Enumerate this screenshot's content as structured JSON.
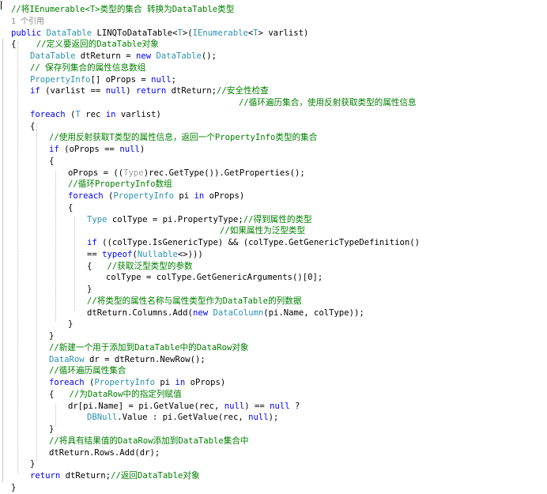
{
  "editor": {
    "lines": [
      {
        "indent": 0,
        "tokens": [
          {
            "t": "//将IEnumerable<T>类型的集合 转换为DataTable类型",
            "c": "cm"
          }
        ]
      },
      {
        "indent": 0,
        "tokens": [
          {
            "t": "1 个引用",
            "c": "ref"
          }
        ]
      },
      {
        "indent": 0,
        "tokens": [
          {
            "t": "public",
            "c": "kw"
          },
          {
            "t": " "
          },
          {
            "t": "DataTable",
            "c": "ty"
          },
          {
            "t": " LINQToDataTable<"
          },
          {
            "t": "T",
            "c": "ty"
          },
          {
            "t": ">("
          },
          {
            "t": "IEnumerable",
            "c": "ty"
          },
          {
            "t": "<"
          },
          {
            "t": "T",
            "c": "ty"
          },
          {
            "t": "> varlist)"
          }
        ]
      },
      {
        "indent": 0,
        "tokens": [
          {
            "t": "{"
          },
          {
            "t": "    "
          },
          {
            "t": "//定义要返回的DataTable对象",
            "c": "cm"
          }
        ]
      },
      {
        "indent": 1,
        "tokens": [
          {
            "t": "DataTable",
            "c": "ty"
          },
          {
            "t": " dtReturn = "
          },
          {
            "t": "new",
            "c": "kw"
          },
          {
            "t": " "
          },
          {
            "t": "DataTable",
            "c": "ty"
          },
          {
            "t": "();"
          }
        ]
      },
      {
        "indent": 1,
        "tokens": [
          {
            "t": "// 保存列集合的属性信息数组",
            "c": "cm"
          }
        ]
      },
      {
        "indent": 1,
        "tokens": [
          {
            "t": "PropertyInfo",
            "c": "ty"
          },
          {
            "t": "[] oProps = "
          },
          {
            "t": "null",
            "c": "kw"
          },
          {
            "t": ";"
          }
        ]
      },
      {
        "indent": 1,
        "tokens": [
          {
            "t": "if",
            "c": "kw"
          },
          {
            "t": " (varlist == "
          },
          {
            "t": "null",
            "c": "kw"
          },
          {
            "t": ") "
          },
          {
            "t": "return",
            "c": "kw"
          },
          {
            "t": " dtReturn;"
          },
          {
            "t": "//安全性检查",
            "c": "cm"
          }
        ]
      },
      {
        "indent": 12,
        "tokens": [
          {
            "t": "//循环遍历集合，使用反射获取类型的属性信息",
            "c": "cm"
          }
        ]
      },
      {
        "indent": 1,
        "tokens": [
          {
            "t": "foreach",
            "c": "kw"
          },
          {
            "t": " ("
          },
          {
            "t": "T",
            "c": "ty"
          },
          {
            "t": " rec "
          },
          {
            "t": "in",
            "c": "kw"
          },
          {
            "t": " varlist)"
          }
        ]
      },
      {
        "indent": 1,
        "tokens": [
          {
            "t": "{"
          }
        ]
      },
      {
        "indent": 2,
        "tokens": [
          {
            "t": "//使用反射获取T类型的属性信息，返回一个PropertyInfo类型的集合",
            "c": "cm"
          }
        ]
      },
      {
        "indent": 2,
        "tokens": [
          {
            "t": "if",
            "c": "kw"
          },
          {
            "t": " (oProps == "
          },
          {
            "t": "null",
            "c": "kw"
          },
          {
            "t": ")"
          }
        ]
      },
      {
        "indent": 2,
        "tokens": [
          {
            "t": "{"
          }
        ]
      },
      {
        "indent": 3,
        "tokens": [
          {
            "t": "oProps = (("
          },
          {
            "t": "Type",
            "c": "gy"
          },
          {
            "t": ")rec.GetType()).GetProperties();"
          }
        ]
      },
      {
        "indent": 3,
        "tokens": [
          {
            "t": "//循环PropertyInfo数组",
            "c": "cm"
          }
        ]
      },
      {
        "indent": 3,
        "tokens": [
          {
            "t": "foreach",
            "c": "kw"
          },
          {
            "t": " ("
          },
          {
            "t": "PropertyInfo",
            "c": "ty"
          },
          {
            "t": " pi "
          },
          {
            "t": "in",
            "c": "kw"
          },
          {
            "t": " oProps)"
          }
        ]
      },
      {
        "indent": 3,
        "tokens": [
          {
            "t": "{"
          }
        ]
      },
      {
        "indent": 4,
        "tokens": [
          {
            "t": "Type",
            "c": "ty"
          },
          {
            "t": " colType = pi.PropertyType;"
          },
          {
            "t": "//得到属性的类型",
            "c": "cm"
          }
        ]
      },
      {
        "indent": 11,
        "tokens": [
          {
            "t": "//如果属性为泛型类型",
            "c": "cm"
          }
        ]
      },
      {
        "indent": 4,
        "tokens": [
          {
            "t": "if",
            "c": "kw"
          },
          {
            "t": " ((colType.IsGenericType) && (colType.GetGenericTypeDefinition()"
          }
        ]
      },
      {
        "indent": 4,
        "tokens": [
          {
            "t": "== "
          },
          {
            "t": "typeof",
            "c": "kw"
          },
          {
            "t": "("
          },
          {
            "t": "Nullable",
            "c": "ty"
          },
          {
            "t": "<>)))"
          }
        ]
      },
      {
        "indent": 4,
        "tokens": [
          {
            "t": "{"
          },
          {
            "t": "   "
          },
          {
            "t": "//获取泛型类型的参数",
            "c": "cm"
          }
        ]
      },
      {
        "indent": 5,
        "tokens": [
          {
            "t": "colType = colType.GetGenericArguments()[0];"
          }
        ]
      },
      {
        "indent": 4,
        "tokens": [
          {
            "t": "}"
          }
        ]
      },
      {
        "indent": 4,
        "tokens": [
          {
            "t": "//将类型的属性名称与属性类型作为DataTable的列数据",
            "c": "cm"
          }
        ]
      },
      {
        "indent": 4,
        "tokens": [
          {
            "t": "dtReturn.Columns.Add("
          },
          {
            "t": "new",
            "c": "kw"
          },
          {
            "t": " "
          },
          {
            "t": "DataColumn",
            "c": "ty"
          },
          {
            "t": "(pi.Name, colType));"
          }
        ]
      },
      {
        "indent": 3,
        "tokens": [
          {
            "t": "}"
          }
        ]
      },
      {
        "indent": 2,
        "tokens": [
          {
            "t": "}"
          }
        ]
      },
      {
        "indent": 2,
        "tokens": [
          {
            "t": "//新建一个用于添加到DataTable中的DataRow对象",
            "c": "cm"
          }
        ]
      },
      {
        "indent": 2,
        "tokens": [
          {
            "t": "DataRow",
            "c": "ty"
          },
          {
            "t": " dr = dtReturn.NewRow();"
          }
        ]
      },
      {
        "indent": 2,
        "tokens": [
          {
            "t": "//循环遍历属性集合",
            "c": "cm"
          }
        ]
      },
      {
        "indent": 2,
        "tokens": [
          {
            "t": "foreach",
            "c": "kw"
          },
          {
            "t": " ("
          },
          {
            "t": "PropertyInfo",
            "c": "ty"
          },
          {
            "t": " pi "
          },
          {
            "t": "in",
            "c": "kw"
          },
          {
            "t": " oProps)"
          }
        ]
      },
      {
        "indent": 2,
        "tokens": [
          {
            "t": "{"
          },
          {
            "t": "   "
          },
          {
            "t": "//为DataRow中的指定列赋值",
            "c": "cm"
          }
        ]
      },
      {
        "indent": 3,
        "tokens": [
          {
            "t": "dr[pi.Name] = pi.GetValue(rec, "
          },
          {
            "t": "null",
            "c": "kw"
          },
          {
            "t": ") == "
          },
          {
            "t": "null",
            "c": "kw"
          },
          {
            "t": " ?"
          }
        ]
      },
      {
        "indent": 4,
        "tokens": [
          {
            "t": "DBNull",
            "c": "ty"
          },
          {
            "t": ".Value : pi.GetValue(rec, "
          },
          {
            "t": "null",
            "c": "kw"
          },
          {
            "t": ");"
          }
        ]
      },
      {
        "indent": 2,
        "tokens": [
          {
            "t": "}"
          }
        ]
      },
      {
        "indent": 2,
        "tokens": [
          {
            "t": "//将具有结果值的DataRow添加到DataTable集合中",
            "c": "cm"
          }
        ]
      },
      {
        "indent": 2,
        "tokens": [
          {
            "t": "dtReturn.Rows.Add(dr);"
          }
        ]
      },
      {
        "indent": 1,
        "tokens": [
          {
            "t": "}"
          }
        ]
      },
      {
        "indent": 1,
        "tokens": [
          {
            "t": "return",
            "c": "kw"
          },
          {
            "t": " dtReturn;"
          },
          {
            "t": "//返回DataTable对象",
            "c": "cm"
          }
        ]
      },
      {
        "indent": 0,
        "tokens": [
          {
            "t": "}"
          }
        ]
      }
    ]
  }
}
